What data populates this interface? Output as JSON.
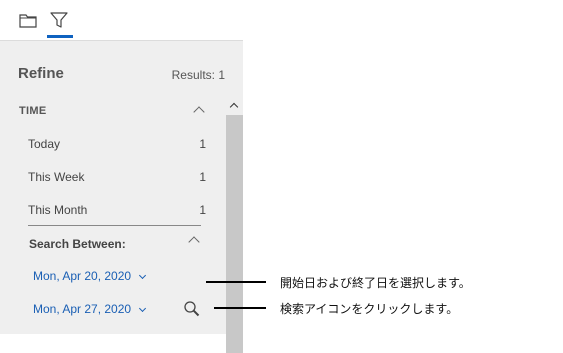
{
  "tabs": [
    {
      "icon": "folder-icon"
    },
    {
      "icon": "filter-icon",
      "active": true
    }
  ],
  "panel": {
    "title": "Refine",
    "results": "Results: 1",
    "time_section": {
      "label": "TIME",
      "items": [
        {
          "label": "Today",
          "count": "1"
        },
        {
          "label": "This Week",
          "count": "1"
        },
        {
          "label": "This Month",
          "count": "1"
        }
      ]
    },
    "search_between": {
      "label": "Search Between:",
      "start_date": "Mon, Apr 20, 2020",
      "end_date": "Mon, Apr 27, 2020"
    }
  },
  "callouts": {
    "date_range": "開始日および終了日を選択します。",
    "search_icon": "検索アイコンをクリックします。"
  },
  "colors": {
    "accent": "#0f62c0",
    "link": "#1a5fb4",
    "panel_bg": "#efefef"
  }
}
